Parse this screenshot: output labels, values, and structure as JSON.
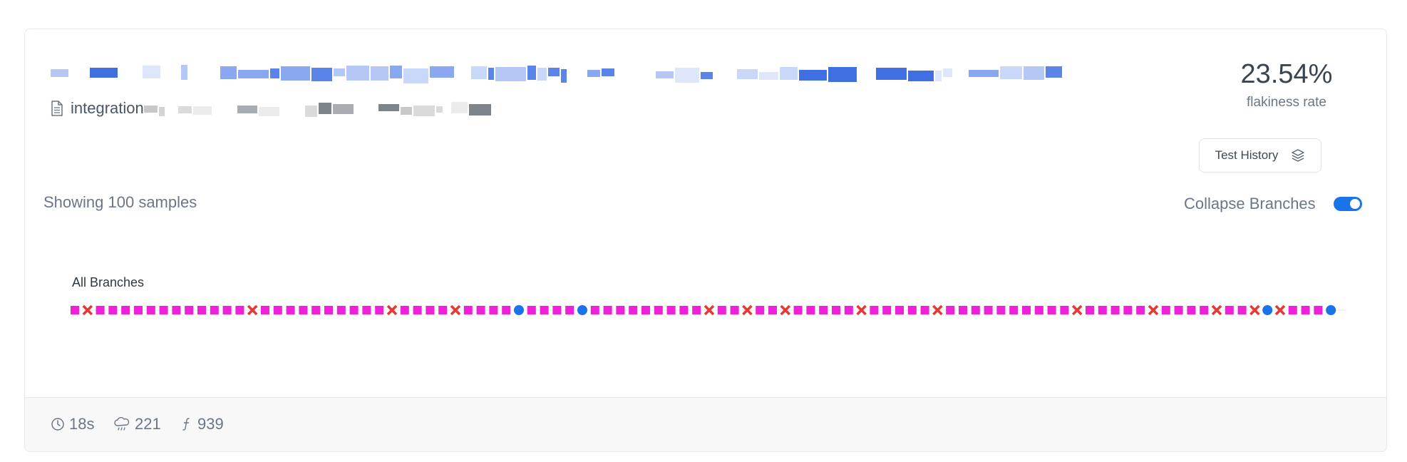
{
  "header": {
    "file_label": "integration"
  },
  "rate": {
    "value": "23.54%",
    "label": "flakiness rate"
  },
  "history_button": {
    "label": "Test History",
    "icon": "layers-icon"
  },
  "samples_text": "Showing 100 samples",
  "collapse": {
    "label": "Collapse Branches",
    "enabled": true
  },
  "branch": {
    "label": "All Branches",
    "results": [
      "pass",
      "fail",
      "pass",
      "pass",
      "pass",
      "pass",
      "pass",
      "pass",
      "pass",
      "pass",
      "pass",
      "pass",
      "pass",
      "pass",
      "fail",
      "pass",
      "pass",
      "pass",
      "pass",
      "pass",
      "pass",
      "pass",
      "pass",
      "pass",
      "pass",
      "fail",
      "pass",
      "pass",
      "pass",
      "pass",
      "fail",
      "pass",
      "pass",
      "pass",
      "pass",
      "other",
      "pass",
      "pass",
      "pass",
      "pass",
      "other",
      "pass",
      "pass",
      "pass",
      "pass",
      "pass",
      "pass",
      "pass",
      "pass",
      "pass",
      "fail",
      "pass",
      "pass",
      "fail",
      "pass",
      "pass",
      "fail",
      "pass",
      "pass",
      "pass",
      "pass",
      "pass",
      "fail",
      "pass",
      "pass",
      "pass",
      "pass",
      "pass",
      "fail",
      "pass",
      "pass",
      "pass",
      "pass",
      "pass",
      "pass",
      "pass",
      "pass",
      "pass",
      "pass",
      "fail",
      "pass",
      "pass",
      "pass",
      "pass",
      "pass",
      "fail",
      "pass",
      "pass",
      "pass",
      "pass",
      "fail",
      "pass",
      "pass",
      "fail",
      "other",
      "fail",
      "pass",
      "pass",
      "pass",
      "other"
    ],
    "legend_colors": {
      "pass": "#f01fd8",
      "fail": "#e53935",
      "other": "#1a73e8"
    }
  },
  "footer": {
    "duration": "18s",
    "runs": "221",
    "functions": "939"
  },
  "colors": {
    "accent": "#1a73e8",
    "pass": "#f01fd8",
    "fail": "#e53935",
    "border": "#e4e7eb"
  }
}
